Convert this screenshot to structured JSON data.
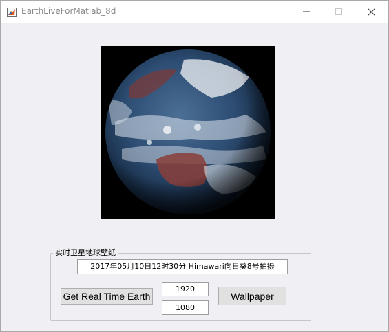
{
  "window": {
    "title": "EarthLiveForMatlab_8d",
    "controls": [
      "minimize",
      "maximize",
      "close"
    ]
  },
  "image": {
    "description_icon": "earth-image"
  },
  "panel": {
    "legend": "实时卫星地球壁纸",
    "info_text": "2017年05月10日12时30分 Himawari向日葵8号拍摄",
    "get_button_label": "Get Real Time Earth",
    "width_value": "1920",
    "height_value": "1080",
    "wallpaper_button_label": "Wallpaper"
  },
  "colors": {
    "window_bg": "#f0eff3",
    "titlebar_bg": "#ffffff",
    "button_bg": "#e1e1e1"
  }
}
